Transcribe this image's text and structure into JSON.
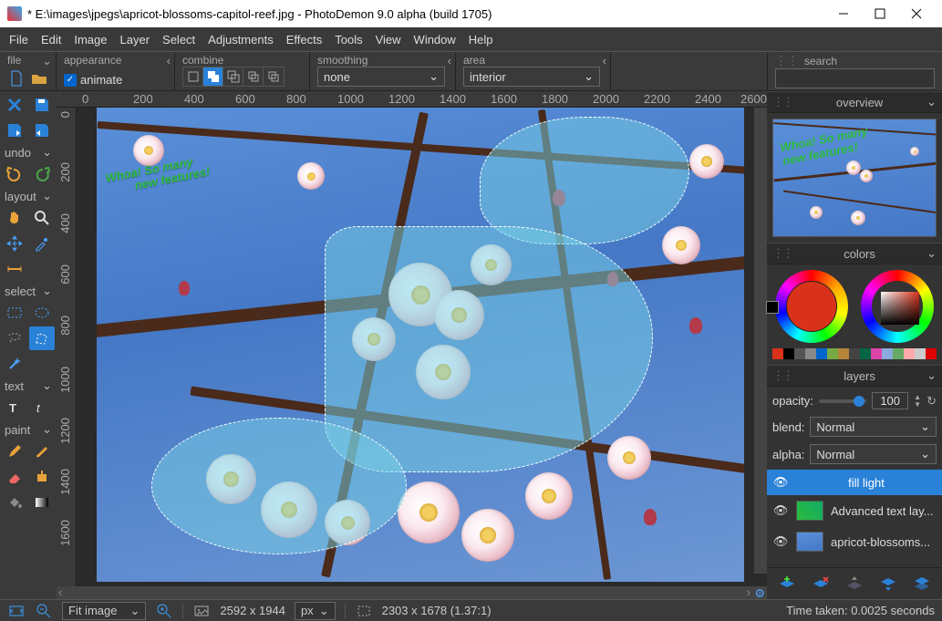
{
  "window": {
    "title": "* E:\\images\\jpegs\\apricot-blossoms-capitol-reef.jpg  -  PhotoDemon 9.0 alpha (build 1705)"
  },
  "menu": [
    "File",
    "Edit",
    "Image",
    "Layer",
    "Select",
    "Adjustments",
    "Effects",
    "Tools",
    "View",
    "Window",
    "Help"
  ],
  "optionbar": {
    "file_label": "file",
    "appearance_label": "appearance",
    "animate_label": "animate",
    "combine_label": "combine",
    "smoothing_label": "smoothing",
    "smoothing_value": "none",
    "area_label": "area",
    "area_value": "interior",
    "search_label": "search"
  },
  "toolbox": {
    "undo_label": "undo",
    "layout_label": "layout",
    "select_label": "select",
    "text_label": "text",
    "paint_label": "paint"
  },
  "ruler_h": [
    "0",
    "200",
    "400",
    "600",
    "800",
    "1000",
    "1200",
    "1400",
    "1600",
    "1800",
    "2000",
    "2200",
    "2400",
    "2600"
  ],
  "ruler_v": [
    "0",
    "200",
    "400",
    "600",
    "800",
    "1000",
    "1200",
    "1400",
    "1600"
  ],
  "canvas_text": {
    "line1": "Whoa!  So many",
    "line2": "new features!"
  },
  "panels": {
    "overview_label": "overview",
    "colors_label": "colors",
    "layers_label": "layers",
    "opacity_label": "opacity:",
    "opacity_value": "100",
    "blend_label": "blend:",
    "blend_value": "Normal",
    "alpha_label": "alpha:",
    "alpha_value": "Normal",
    "layers": [
      {
        "name": "fill light"
      },
      {
        "name": "Advanced text lay..."
      },
      {
        "name": "apricot-blossoms..."
      }
    ],
    "swatches": [
      "#d8321a",
      "#000",
      "#555",
      "#888",
      "#06c",
      "#7a4",
      "#b5853a",
      "#444",
      "#064",
      "#d4a",
      "#8ad",
      "#6a6",
      "#faa",
      "#ccc",
      "#d00"
    ]
  },
  "status": {
    "zoom_value": "Fit image",
    "image_size": "2592 x 1944",
    "units": "px",
    "selection_info": "2303 x 1678  (1.37:1)",
    "time_label": "Time taken: 0.0025 seconds"
  }
}
